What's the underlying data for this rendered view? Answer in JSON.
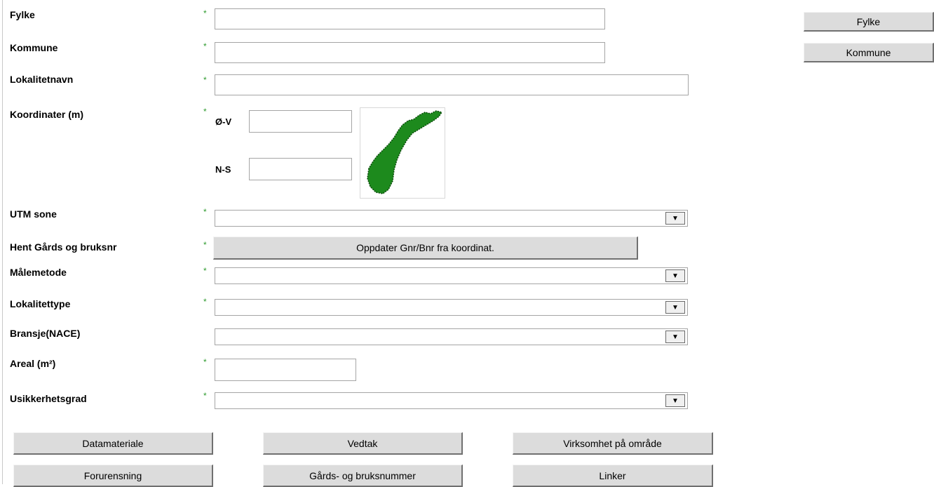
{
  "required_marker": "*",
  "form": {
    "fylke_label": "Fylke",
    "kommune_label": "Kommune",
    "lokalitetnavn_label": "Lokalitetnavn",
    "koordinater_label": "Koordinater (m)",
    "ov_label": "Ø-V",
    "ns_label": "N-S",
    "utm_label": "UTM sone",
    "hent_label": "Hent Gårds og bruksnr",
    "hent_button": "Oppdater Gnr/Bnr fra koordinat.",
    "malemetode_label": "Målemetode",
    "lokalitettype_label": "Lokalitettype",
    "bransje_label": "Bransje(NACE)",
    "areal_label": "Areal (m²)",
    "usikkerhet_label": "Usikkerhetsgrad",
    "fylke_value": "",
    "kommune_value": "",
    "lokalitetnavn_value": "",
    "ov_value": "",
    "ns_value": "",
    "areal_value": "",
    "dropdown_arrow": "▼"
  },
  "side_buttons": {
    "fylke": "Fylke",
    "kommune": "Kommune"
  },
  "bottom_buttons": {
    "datamateriale": "Datamateriale",
    "vedtak": "Vedtak",
    "virksomhet": "Virksomhet på område",
    "forurensning": "Forurensning",
    "gards": "Gårds- og bruksnummer",
    "linker": "Linker"
  },
  "map": {
    "icon": "norway-map-icon",
    "fill_color": "#1d8a1d",
    "outline_color": "#0a4a0a"
  }
}
